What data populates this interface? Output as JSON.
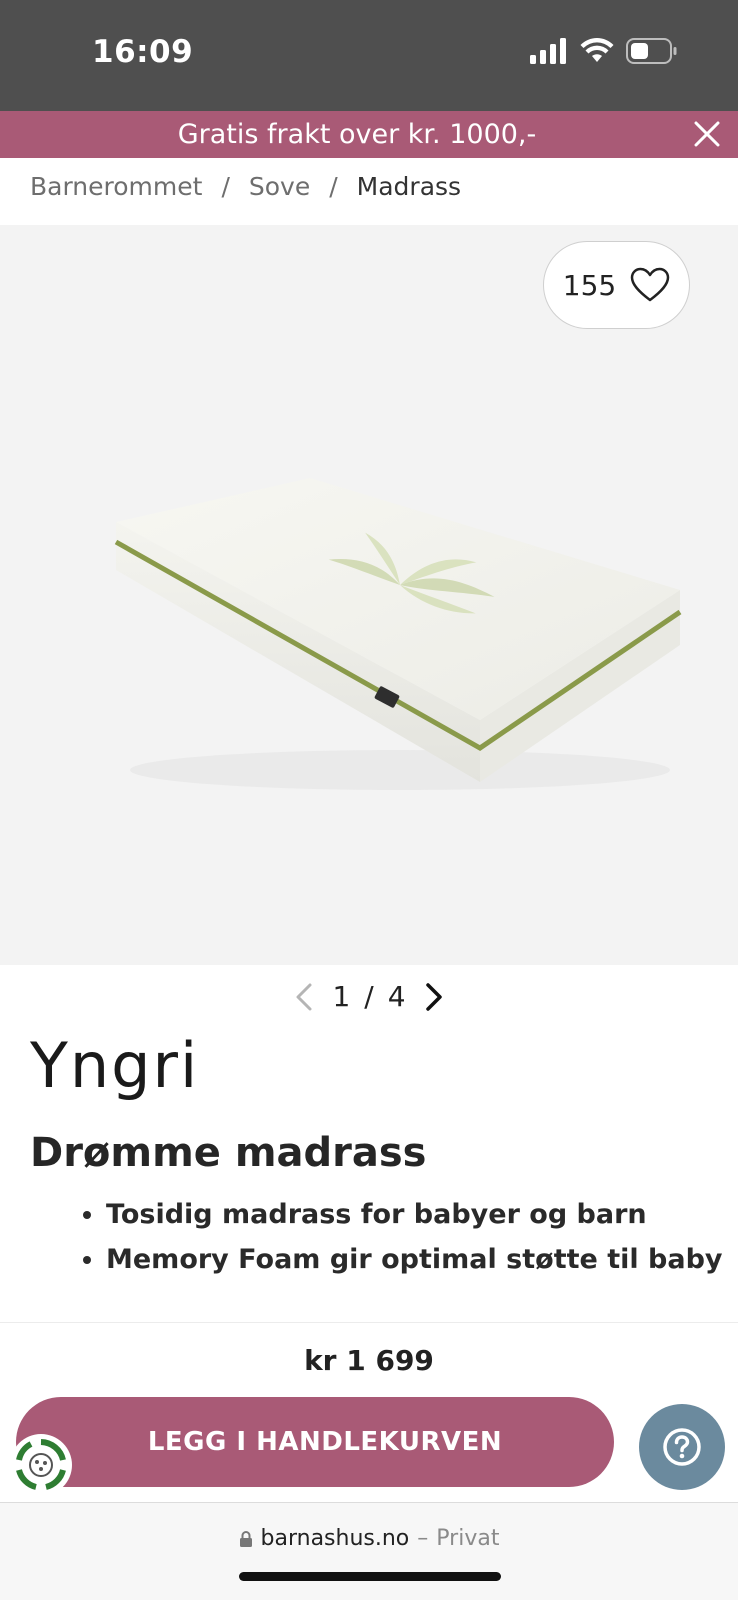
{
  "status_bar": {
    "time": "16:09",
    "icons": [
      "signal-icon",
      "wifi-icon",
      "battery-icon"
    ]
  },
  "promo": {
    "text": "Gratis frakt over kr. 1000,-",
    "close_icon": "close-icon"
  },
  "breadcrumb": {
    "items": [
      "Barnerommet",
      "Sove",
      "Madrass"
    ],
    "separator": "/"
  },
  "gallery": {
    "favorite_count": "155",
    "favorite_icon": "heart-icon",
    "current": "1",
    "separator": "/",
    "total": "4"
  },
  "product": {
    "brand": "Yngri",
    "title": "Drømme madrass",
    "features": [
      "Tosidig madrass for babyer og barn",
      "Memory Foam gir optimal støtte til baby"
    ],
    "price": "kr 1 699"
  },
  "actions": {
    "add_to_cart": "LEGG I HANDLEKURVEN",
    "help_icon": "help-icon"
  },
  "browser": {
    "domain": "barnashus.no",
    "dash": "–",
    "mode": "Privat"
  },
  "colors": {
    "accent": "#a95a76",
    "help": "#6b8a9e",
    "status_bar": "#4f4f4f"
  }
}
